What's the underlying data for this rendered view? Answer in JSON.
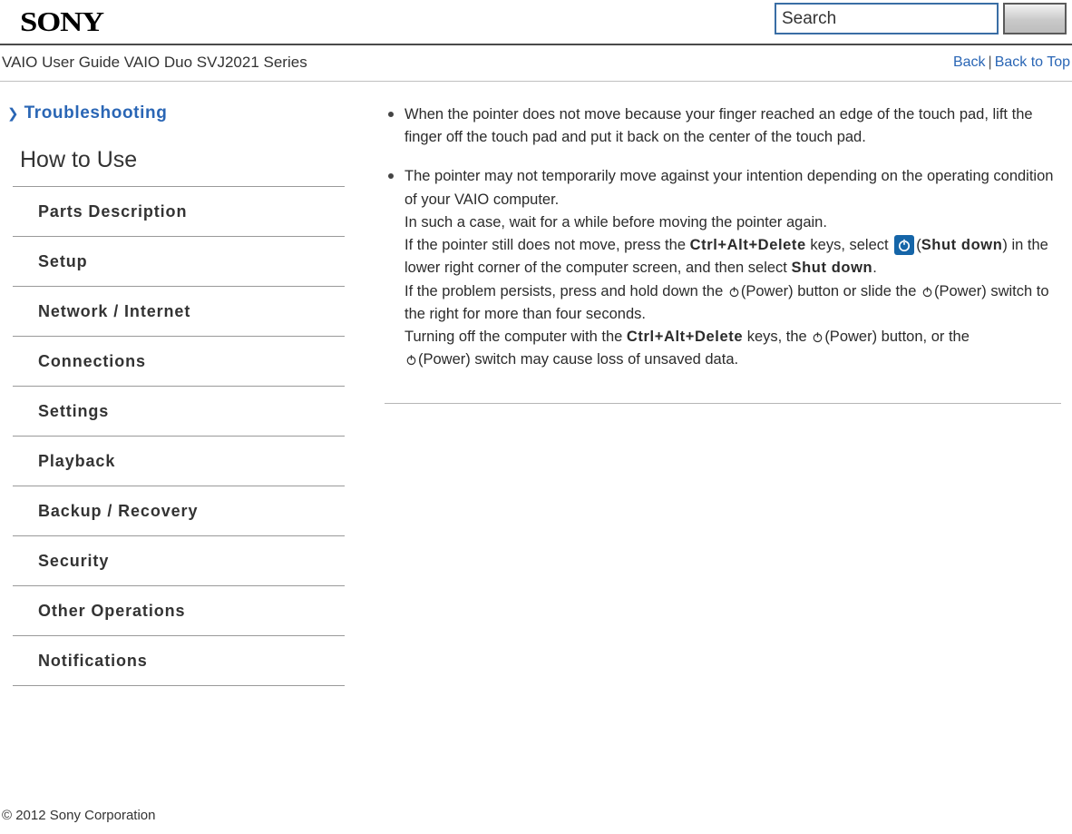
{
  "header": {
    "logo_text": "SONY",
    "search_placeholder": "Search",
    "search_value": "",
    "search_button_label": ""
  },
  "titlebar": {
    "guide_title": "VAIO User Guide VAIO Duo SVJ2021 Series",
    "back_label": "Back",
    "separator": "|",
    "back_to_top_label": "Back to Top"
  },
  "sidebar": {
    "breadcrumb_arrow": "❯",
    "breadcrumb_label": "Troubleshooting",
    "section_title": "How to Use",
    "items": [
      {
        "label": "Parts Description"
      },
      {
        "label": "Setup"
      },
      {
        "label": "Network / Internet"
      },
      {
        "label": "Connections"
      },
      {
        "label": "Settings"
      },
      {
        "label": "Playback"
      },
      {
        "label": "Backup / Recovery"
      },
      {
        "label": "Security"
      },
      {
        "label": "Other Operations"
      },
      {
        "label": "Notifications"
      }
    ]
  },
  "main": {
    "bullet1": "When the pointer does not move because your finger reached an edge of the touch pad, lift the finger off the touch pad and put it back on the center of the touch pad.",
    "bullet2": {
      "line1": "The pointer may not temporarily move against your intention depending on the operating condition of your VAIO computer.",
      "line2": "In such a case, wait for a while before moving the pointer again.",
      "line3_a": "If the pointer still does not move, press the ",
      "line3_keys": "Ctrl+Alt+Delete",
      "line3_b": " keys, select ",
      "line3_c": "(",
      "line3_shut": "Shut down",
      "line3_d": ") in the lower right corner of the computer screen, and then select ",
      "line3_shut2": "Shut down",
      "line3_e": ".",
      "line4_a": "If the problem persists, press and hold down the ",
      "line4_b": "(Power) button or slide the ",
      "line4_c": "(Power) switch to the right for more than four seconds.",
      "line5_a": "Turning off the computer with the ",
      "line5_keys": "Ctrl+Alt+Delete",
      "line5_b": " keys, the ",
      "line5_c": "(Power) button, or the ",
      "line5_d": "(Power) switch may cause loss of unsaved data."
    }
  },
  "footer": {
    "copyright": "© 2012 Sony Corporation"
  },
  "colors": {
    "link": "#2a66b5",
    "accent": "#3a6ea5",
    "icon_blue": "#1565a8"
  }
}
